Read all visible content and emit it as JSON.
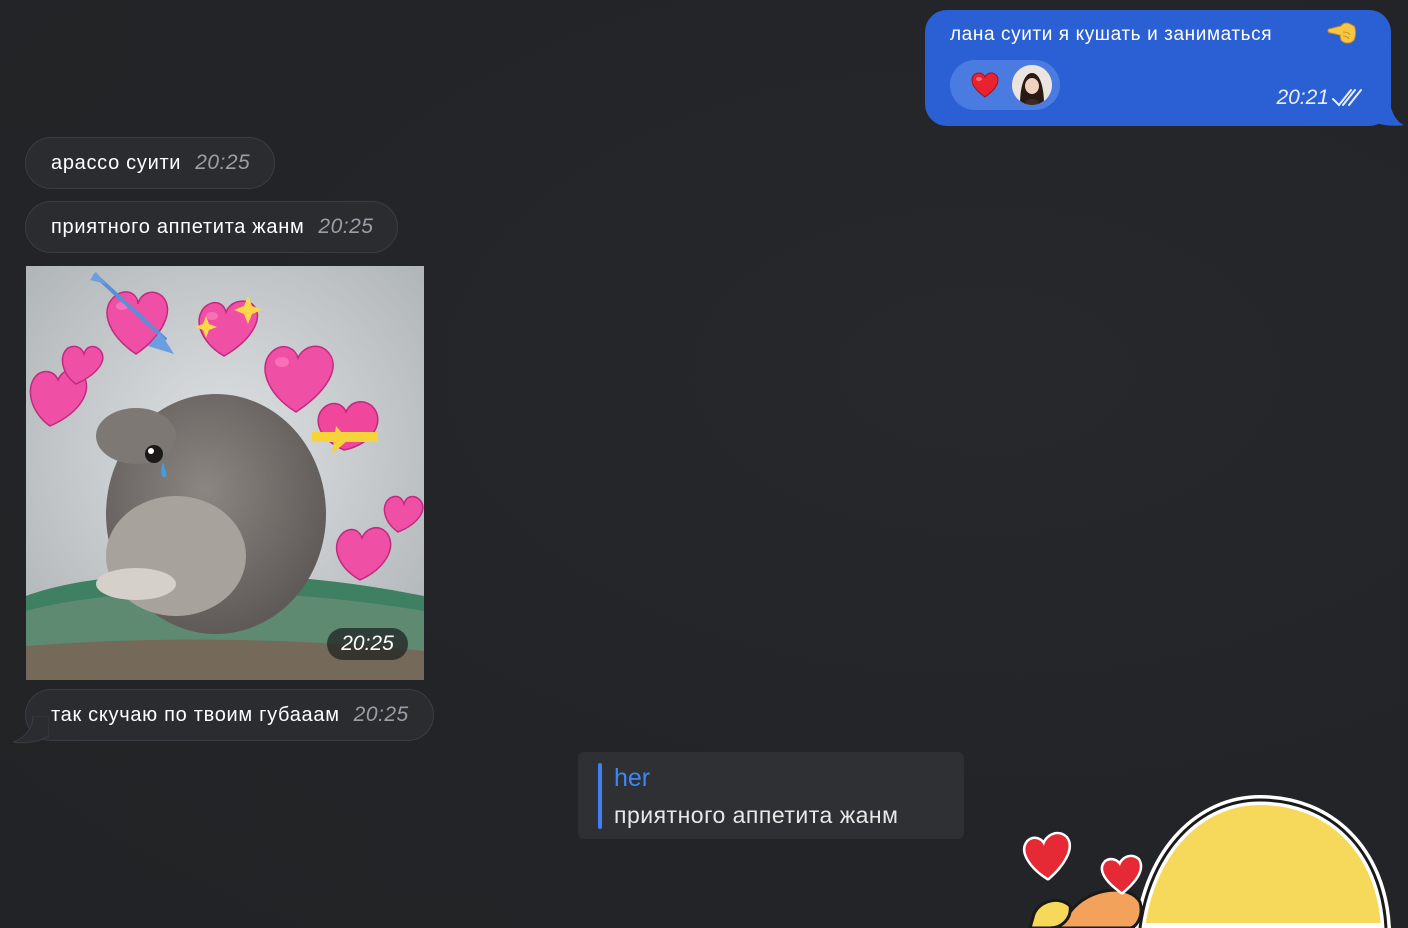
{
  "outgoing_message": {
    "text": "лана суити я кушать и заниматься",
    "emoji": "pointing-left-hand-icon",
    "time": "20:21",
    "status": "read",
    "reactions": [
      "heart-icon"
    ],
    "bubble_color": "#2a60d4"
  },
  "incoming_messages": [
    {
      "text": "арассо суити",
      "time": "20:25"
    },
    {
      "text": "приятного аппетита жанм",
      "time": "20:25"
    },
    {
      "text": "так скучаю по твоим губааам",
      "time": "20:25"
    }
  ],
  "image_message": {
    "time": "20:25"
  },
  "reply_preview": {
    "author": "her",
    "text": "приятного аппетита жанм",
    "accent_color": "#3e86f3"
  },
  "colors": {
    "background": "#222427",
    "incoming_bubble": "#2a2c30",
    "time_gray": "#9a9ea6"
  }
}
